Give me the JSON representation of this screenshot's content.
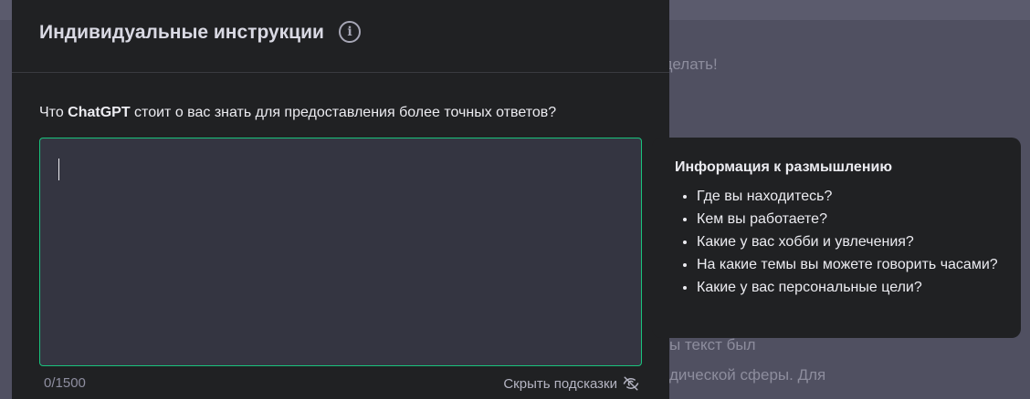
{
  "background": {
    "fragments": [
      "сделать!",
      "ы текст был",
      "дической сферы. Для"
    ]
  },
  "modal": {
    "title": "Индивидуальные инструкции",
    "question_prefix": "Что ",
    "question_brand": "ChatGPT",
    "question_suffix": " стоит о вас знать для предоставления более точных ответов?",
    "textarea_value": "",
    "counter": "0/1500",
    "hide_hints_label": "Скрыть подсказки"
  },
  "hints": {
    "title": "Информация к размышлению",
    "items": [
      "Где вы находитесь?",
      "Кем вы работаете?",
      "Какие у вас хобби и увлечения?",
      "На какие темы вы можете говорить часами?",
      "Какие у вас персональные цели?"
    ]
  },
  "colors": {
    "accent_border": "#19c37d",
    "modal_bg": "#202123",
    "textarea_bg": "#343541",
    "overlay": "#505061"
  },
  "icons": {
    "info": "info-circle-icon",
    "hide": "eye-off-icon"
  }
}
